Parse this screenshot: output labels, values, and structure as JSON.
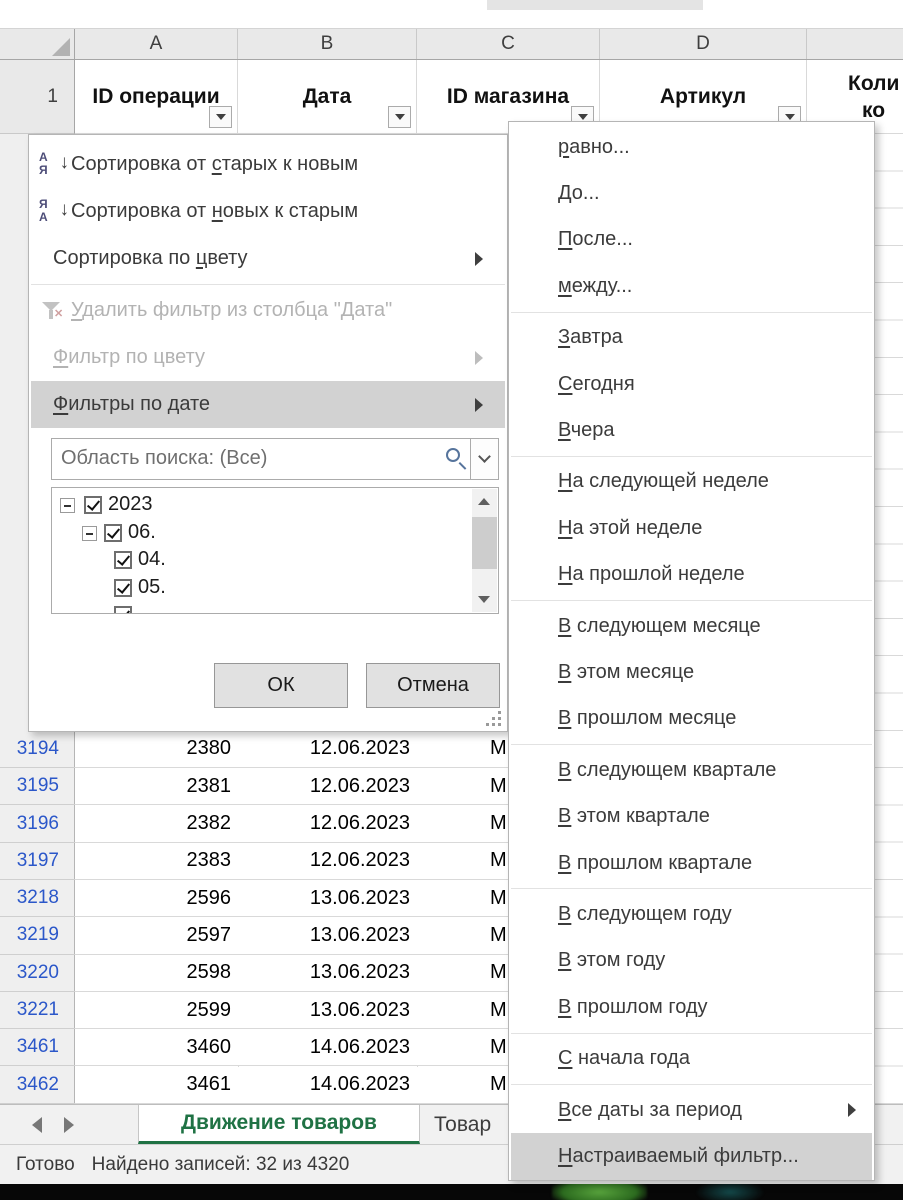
{
  "sheet": {
    "col_letters": [
      "A",
      "B",
      "C",
      "D"
    ],
    "row1_label": "1",
    "headers": [
      {
        "label": "ID операции"
      },
      {
        "label": "Дата"
      },
      {
        "label": "ID магазина"
      },
      {
        "label": "Артикул"
      }
    ],
    "header_e": {
      "line1": "Коли",
      "line2": "ко"
    },
    "rows": [
      {
        "num": "3194",
        "id": "2380",
        "date": "12.06.2023",
        "store": "М"
      },
      {
        "num": "3195",
        "id": "2381",
        "date": "12.06.2023",
        "store": "М"
      },
      {
        "num": "3196",
        "id": "2382",
        "date": "12.06.2023",
        "store": "М"
      },
      {
        "num": "3197",
        "id": "2383",
        "date": "12.06.2023",
        "store": "М"
      },
      {
        "num": "3218",
        "id": "2596",
        "date": "13.06.2023",
        "store": "М"
      },
      {
        "num": "3219",
        "id": "2597",
        "date": "13.06.2023",
        "store": "М"
      },
      {
        "num": "3220",
        "id": "2598",
        "date": "13.06.2023",
        "store": "М"
      },
      {
        "num": "3221",
        "id": "2599",
        "date": "13.06.2023",
        "store": "М"
      },
      {
        "num": "3461",
        "id": "3460",
        "date": "14.06.2023",
        "store": "М"
      },
      {
        "num": "3462",
        "id": "3461",
        "date": "14.06.2023",
        "store": "М"
      }
    ]
  },
  "filter_menu": {
    "items": [
      {
        "name": "sort-oldest-to-newest",
        "icon": "sort-asc",
        "pre": "Сортировка от ",
        "u": "с",
        "post": "тарых к новым"
      },
      {
        "name": "sort-newest-to-oldest",
        "icon": "sort-desc",
        "pre": "Сортировка от ",
        "u": "н",
        "post": "овых к старым"
      },
      {
        "name": "sort-by-color",
        "pre": "Сортировка по ",
        "u": "ц",
        "post": "вету",
        "submenu": true,
        "sep_after": true
      },
      {
        "name": "clear-filter-from-column",
        "icon": "clear-filter",
        "pre": "",
        "u": "У",
        "post": "далить фильтр из столбца \"Дата\"",
        "disabled": true
      },
      {
        "name": "filter-by-color",
        "pre": "",
        "u": "Ф",
        "post": "ильтр по цвету",
        "disabled": true,
        "submenu": true
      },
      {
        "name": "date-filters",
        "pre": "",
        "u": "Ф",
        "post": "ильтры по дате",
        "highlighted": true,
        "submenu": true
      }
    ],
    "search_placeholder": "Область поиска: (Все)",
    "tree": [
      {
        "level": 0,
        "expander": true,
        "checked": true,
        "label": "2023"
      },
      {
        "level": 1,
        "expander": true,
        "checked": true,
        "label": "06."
      },
      {
        "level": 2,
        "checked": true,
        "label": "04."
      },
      {
        "level": 2,
        "checked": true,
        "label": "05."
      },
      {
        "level": 2,
        "checked": true,
        "label": ""
      }
    ],
    "ok": "ОК",
    "cancel": "Отмена"
  },
  "date_submenu": {
    "items": [
      {
        "name": "equals",
        "u": "р",
        "post": "авно..."
      },
      {
        "name": "before",
        "u": "Д",
        "post": "о..."
      },
      {
        "name": "after",
        "u": "П",
        "post": "осле..."
      },
      {
        "name": "between",
        "u": "м",
        "post": "ежду...",
        "sep_after": true
      },
      {
        "name": "tomorrow",
        "u": "З",
        "post": "автра"
      },
      {
        "name": "today",
        "u": "С",
        "post": "егодня"
      },
      {
        "name": "yesterday",
        "u": "В",
        "post": "чера",
        "sep_after": true
      },
      {
        "name": "next-week",
        "u": "Н",
        "post": "а следующей неделе"
      },
      {
        "name": "this-week",
        "u": "Н",
        "post": "а этой неделе"
      },
      {
        "name": "last-week",
        "u": "Н",
        "post": "а прошлой неделе",
        "sep_after": true
      },
      {
        "name": "next-month",
        "u": "В",
        "post": " следующем месяце"
      },
      {
        "name": "this-month",
        "u": "В",
        "post": " этом месяце"
      },
      {
        "name": "last-month",
        "u": "В",
        "post": " прошлом месяце",
        "sep_after": true
      },
      {
        "name": "next-quarter",
        "u": "В",
        "post": " следующем квартале"
      },
      {
        "name": "this-quarter",
        "u": "В",
        "post": " этом квартале"
      },
      {
        "name": "last-quarter",
        "u": "В",
        "post": " прошлом квартале",
        "sep_after": true
      },
      {
        "name": "next-year",
        "u": "В",
        "post": " следующем году"
      },
      {
        "name": "this-year",
        "u": "В",
        "post": " этом году"
      },
      {
        "name": "last-year",
        "u": "В",
        "post": " прошлом году",
        "sep_after": true
      },
      {
        "name": "year-to-date",
        "u": "С",
        "post": " начала года",
        "sep_after": true
      },
      {
        "name": "all-dates-in-period",
        "u": "В",
        "post": "се даты за период",
        "submenu": true
      },
      {
        "name": "custom-filter",
        "u": "Н",
        "post": "астраиваемый фильтр...",
        "highlighted": true
      }
    ]
  },
  "tabs": {
    "active": "Движение товаров",
    "next": "Товар"
  },
  "status": {
    "mode": "Готово",
    "found": "Найдено записей: 32 из 4320"
  },
  "colors": {
    "filtered_row_number": "#2b57c9",
    "sheet_tab_green": "#1f7244",
    "menu_highlight": "#d2d2d2",
    "scroll_thumb": "#cdcdcd"
  }
}
